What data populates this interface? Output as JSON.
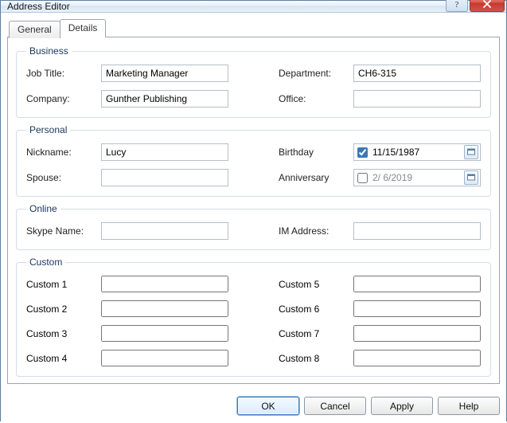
{
  "window": {
    "title": "Address Editor"
  },
  "tabs": {
    "general": "General",
    "details": "Details"
  },
  "groups": {
    "business": {
      "legend": "Business",
      "job_title_label": "Job Title:",
      "job_title_value": "Marketing Manager",
      "company_label": "Company:",
      "company_value": "Gunther Publishing",
      "department_label": "Department:",
      "department_value": "CH6-315",
      "office_label": "Office:",
      "office_value": ""
    },
    "personal": {
      "legend": "Personal",
      "nickname_label": "Nickname:",
      "nickname_value": "Lucy",
      "spouse_label": "Spouse:",
      "spouse_value": "",
      "birthday_label": "Birthday",
      "birthday_checked": true,
      "birthday_value": "11/15/1987",
      "anniversary_label": "Anniversary",
      "anniversary_checked": false,
      "anniversary_value": " 2/ 6/2019"
    },
    "online": {
      "legend": "Online",
      "skype_label": "Skype Name:",
      "skype_value": "",
      "im_label": "IM Address:",
      "im_value": ""
    },
    "custom": {
      "legend": "Custom",
      "labels": [
        "Custom 1",
        "Custom 2",
        "Custom 3",
        "Custom 4",
        "Custom 5",
        "Custom 6",
        "Custom 7",
        "Custom 8"
      ],
      "values": [
        "",
        "",
        "",
        "",
        "",
        "",
        "",
        ""
      ]
    }
  },
  "buttons": {
    "ok": "OK",
    "cancel": "Cancel",
    "apply": "Apply",
    "help": "Help"
  }
}
